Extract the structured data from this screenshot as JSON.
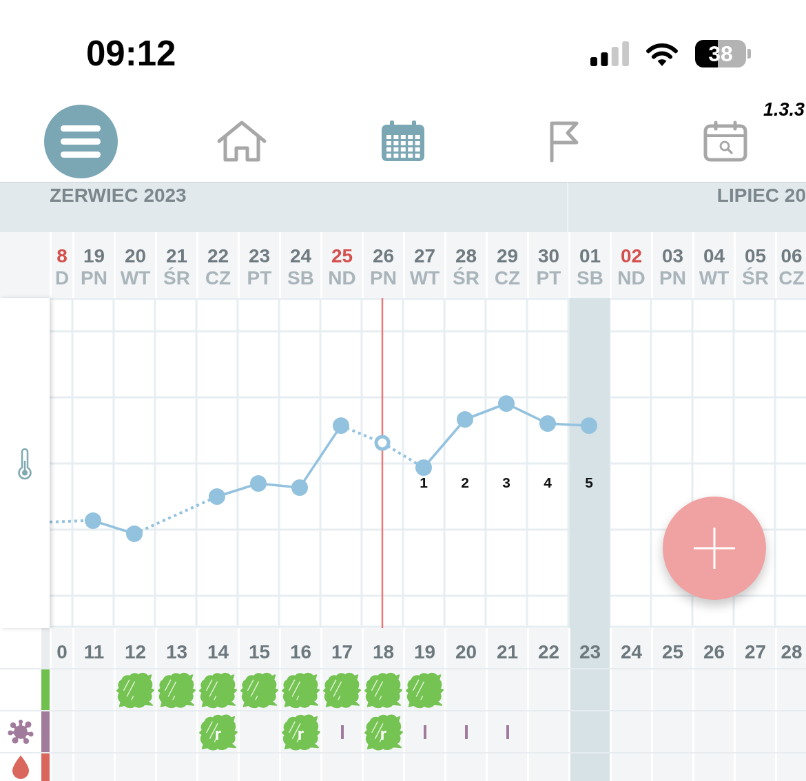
{
  "status_bar": {
    "time": "09:12",
    "battery": "38"
  },
  "nav": {
    "version": "1.3.3",
    "items": [
      {
        "kind": "home",
        "selected": false
      },
      {
        "kind": "calendar",
        "selected": true
      },
      {
        "kind": "flag",
        "selected": false
      },
      {
        "kind": "calendar_search",
        "selected": false
      }
    ]
  },
  "months": [
    {
      "label": "ZERWIEC 2023",
      "days": [
        {
          "date": "8",
          "weekday": "D",
          "sunday": true,
          "today": false,
          "highlighted": false,
          "count": "0"
        },
        {
          "date": "19",
          "weekday": "PN",
          "sunday": false,
          "today": false,
          "highlighted": false,
          "count": "11"
        },
        {
          "date": "20",
          "weekday": "WT",
          "sunday": false,
          "today": false,
          "highlighted": false,
          "count": "12"
        },
        {
          "date": "21",
          "weekday": "ŚR",
          "sunday": false,
          "today": false,
          "highlighted": false,
          "count": "13"
        },
        {
          "date": "22",
          "weekday": "CZ",
          "sunday": false,
          "today": false,
          "highlighted": false,
          "count": "14"
        },
        {
          "date": "23",
          "weekday": "PT",
          "sunday": false,
          "today": false,
          "highlighted": false,
          "count": "15"
        },
        {
          "date": "24",
          "weekday": "SB",
          "sunday": false,
          "today": false,
          "highlighted": false,
          "count": "16"
        },
        {
          "date": "25",
          "weekday": "ND",
          "sunday": true,
          "today": false,
          "highlighted": false,
          "count": "17"
        },
        {
          "date": "26",
          "weekday": "PN",
          "sunday": false,
          "today": true,
          "highlighted": false,
          "count": "18"
        },
        {
          "date": "27",
          "weekday": "WT",
          "sunday": false,
          "today": false,
          "highlighted": false,
          "count": "19",
          "chart_label": "1"
        },
        {
          "date": "28",
          "weekday": "ŚR",
          "sunday": false,
          "today": false,
          "highlighted": false,
          "count": "20",
          "chart_label": "2"
        },
        {
          "date": "29",
          "weekday": "CZ",
          "sunday": false,
          "today": false,
          "highlighted": false,
          "count": "21",
          "chart_label": "3"
        },
        {
          "date": "30",
          "weekday": "PT",
          "sunday": false,
          "today": false,
          "highlighted": false,
          "count": "22",
          "chart_label": "4"
        }
      ]
    },
    {
      "label": "LIPIEC 20",
      "days": [
        {
          "date": "01",
          "weekday": "SB",
          "sunday": false,
          "today": false,
          "highlighted": true,
          "count": "23",
          "chart_label": "5"
        },
        {
          "date": "02",
          "weekday": "ND",
          "sunday": true,
          "today": false,
          "highlighted": false,
          "count": "24"
        },
        {
          "date": "03",
          "weekday": "PN",
          "sunday": false,
          "today": false,
          "highlighted": false,
          "count": "25"
        },
        {
          "date": "04",
          "weekday": "WT",
          "sunday": false,
          "today": false,
          "highlighted": false,
          "count": "26"
        },
        {
          "date": "05",
          "weekday": "ŚR",
          "sunday": false,
          "today": false,
          "highlighted": false,
          "count": "27"
        },
        {
          "date": "06",
          "weekday": "CZ",
          "sunday": false,
          "today": false,
          "highlighted": false,
          "count": "28"
        }
      ]
    }
  ],
  "tracks": [
    {
      "kind": "plain",
      "color": "#6fc04c",
      "cells": [
        {
          "kind": "empty"
        },
        {
          "kind": "empty"
        },
        {
          "kind": "scribble"
        },
        {
          "kind": "scribble"
        },
        {
          "kind": "scribble"
        },
        {
          "kind": "scribble"
        },
        {
          "kind": "scribble"
        },
        {
          "kind": "scribble"
        },
        {
          "kind": "scribble"
        },
        {
          "kind": "scribble"
        },
        {
          "kind": "empty"
        },
        {
          "kind": "empty"
        },
        {
          "kind": "empty"
        },
        {
          "kind": "empty"
        },
        {
          "kind": "empty"
        },
        {
          "kind": "empty"
        },
        {
          "kind": "empty"
        },
        {
          "kind": "empty"
        },
        {
          "kind": "empty"
        }
      ]
    },
    {
      "kind": "splat",
      "color": "#a17b9c",
      "cells": [
        {
          "kind": "empty"
        },
        {
          "kind": "empty"
        },
        {
          "kind": "empty"
        },
        {
          "kind": "empty"
        },
        {
          "kind": "scribble",
          "letter": "r"
        },
        {
          "kind": "empty"
        },
        {
          "kind": "scribble",
          "letter": "r"
        },
        {
          "kind": "bar"
        },
        {
          "kind": "scribble",
          "letter": "r"
        },
        {
          "kind": "bar"
        },
        {
          "kind": "bar"
        },
        {
          "kind": "bar"
        },
        {
          "kind": "empty"
        },
        {
          "kind": "empty"
        },
        {
          "kind": "empty"
        },
        {
          "kind": "empty"
        },
        {
          "kind": "empty"
        },
        {
          "kind": "empty"
        },
        {
          "kind": "empty"
        }
      ]
    },
    {
      "kind": "drop",
      "color": "#d9675d"
    }
  ]
}
